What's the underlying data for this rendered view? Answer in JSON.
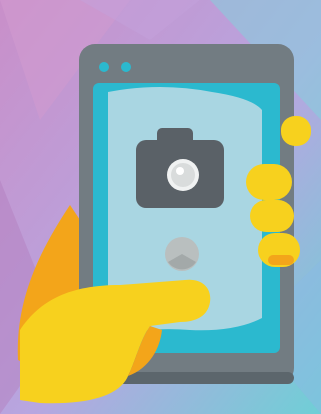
{
  "illustration": {
    "icon": "smartphone-camera-icon",
    "colors": {
      "bg_left": "#c98fc9",
      "bg_mid": "#b7a6e0",
      "bg_right": "#6fcfd6",
      "phone_body": "#727c82",
      "phone_edge": "#5c666c",
      "screen_frame": "#2bb9cf",
      "screen": "#a9d6e2",
      "camera": "#5a6167",
      "lens": "#d9dcdc",
      "hand": "#f7d11e",
      "hand_shadow": "#f3a51a",
      "button": "#b9bfbf"
    }
  }
}
